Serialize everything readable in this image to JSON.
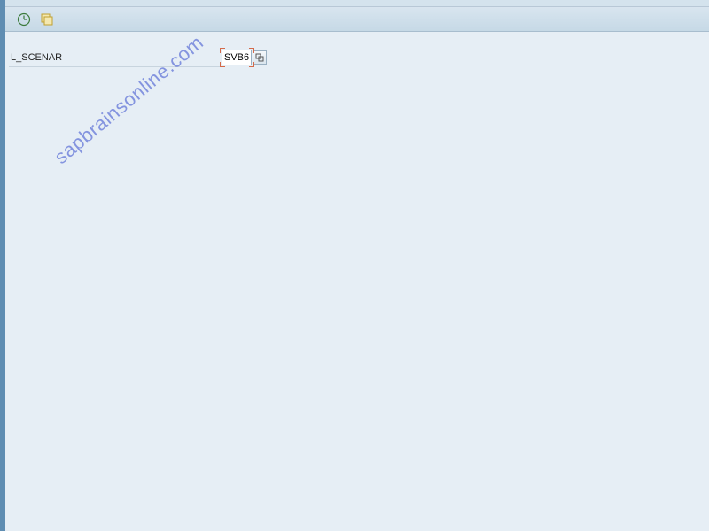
{
  "toolbar": {
    "execute_icon": "execute-icon",
    "variant_icon": "variant-icon"
  },
  "selection": {
    "field_label": "L_SCENAR",
    "field_value": "SVB6"
  },
  "watermark": "sapbrainsonline.com"
}
